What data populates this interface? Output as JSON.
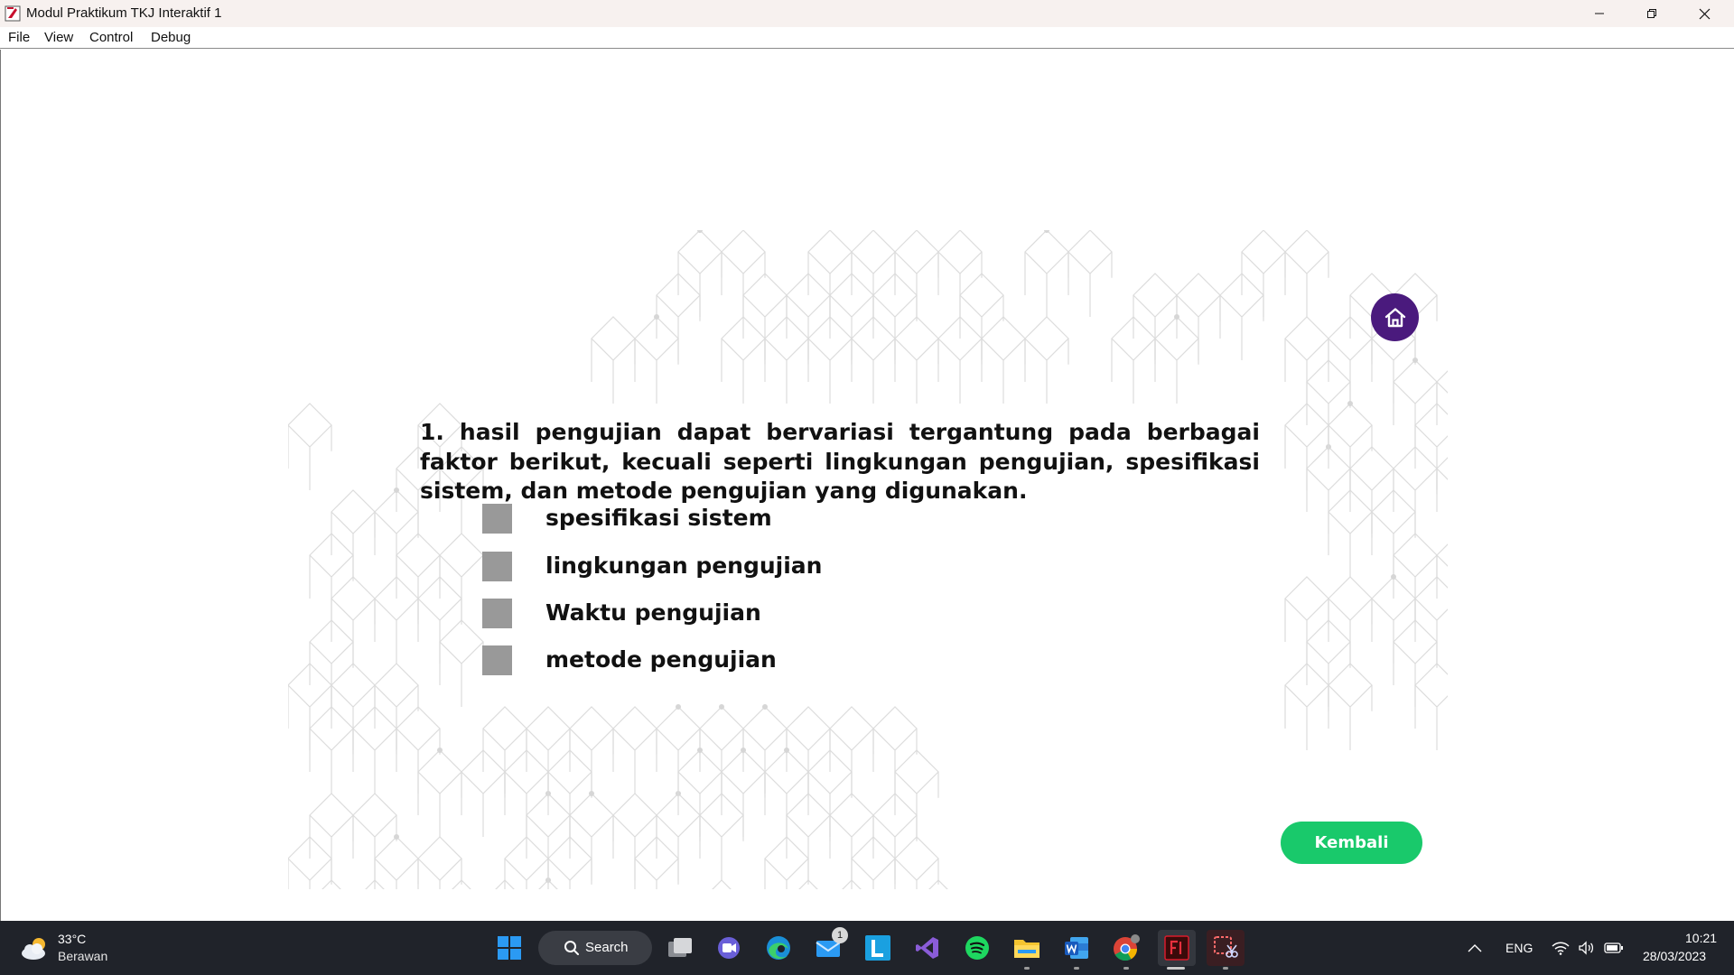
{
  "window": {
    "title": "Modul Praktikum TKJ Interaktif 1"
  },
  "menu": [
    "File",
    "View",
    "Control",
    "Debug"
  ],
  "quiz": {
    "question": "1. hasil pengujian dapat bervariasi tergantung pada berbagai faktor berikut, kecuali seperti lingkungan pengujian, spesifikasi sistem, dan metode pengujian yang digunakan.",
    "options": [
      "spesifikasi sistem",
      "lingkungan pengujian",
      "Waktu pengujian",
      "metode pengujian"
    ],
    "back_label": "Kembali",
    "home_icon": "home-icon"
  },
  "taskbar": {
    "weather": {
      "temp": "33°C",
      "condition": "Berawan"
    },
    "search_label": "Search",
    "mail_badge": "1",
    "tray": {
      "language": "ENG",
      "time": "10:21",
      "date": "28/03/2023"
    }
  },
  "colors": {
    "home_button": "#4a1a7d",
    "back_button": "#19c96b",
    "option_box": "#999999",
    "taskbar": "#20232a"
  }
}
